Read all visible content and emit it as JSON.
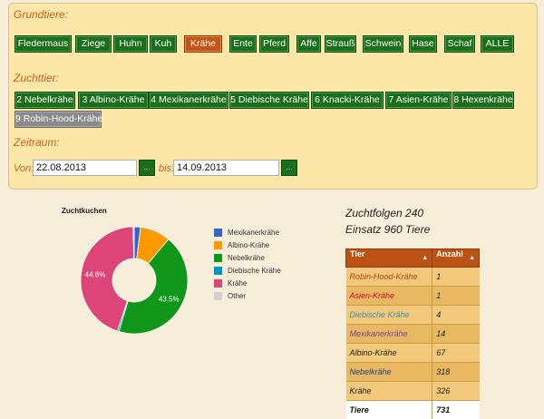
{
  "grundtiere": {
    "label": "Grundtiere:",
    "buttons": [
      "Fledermaus",
      "Ziege",
      "Huhn",
      "Kuh",
      "Krähe",
      "Ente",
      "Pferd",
      "Affe",
      "Strauß",
      "Schwein",
      "Hase",
      "Schaf",
      "ALLE"
    ],
    "active": "Krähe"
  },
  "zuchttier": {
    "label": "Zuchttier:",
    "buttons": [
      "2 Nebelkrähe",
      "3 Albino-Krähe",
      "4 Mexikanerkrähe",
      "5 Diebische Krähe",
      "6 Knacki-Krähe",
      "7 Asien-Krähe",
      "8 Hexenkrähe",
      "9 Robin-Hood-Krähe"
    ],
    "selected": "9 Robin-Hood-Krähe"
  },
  "zeitraum": {
    "label": "Zeitraum:",
    "von_label": "Von:",
    "von_value": "22.08.2013",
    "bis_label": "bis:",
    "bis_value": "14.09.2013",
    "picker_label": "..."
  },
  "chart_data": {
    "type": "pie",
    "title": "Zuchtkuchen",
    "donut": true,
    "legend_position": "right",
    "labels": [
      "Mexikanerkrähe",
      "Albino-Krähe",
      "Nebelkrähe",
      "Diebische Krähe",
      "Krähe",
      "Other"
    ],
    "values": [
      1.9,
      9.2,
      43.5,
      0.5,
      44.6,
      0.3
    ],
    "colors": [
      "#3366cc",
      "#ff9900",
      "#109618",
      "#0099c6",
      "#dd4477",
      "#d0d0d0"
    ],
    "data_labels": [
      "43.5%",
      "44.6%"
    ]
  },
  "stats": {
    "zuchtfolgen": "Zuchtfolgen 240",
    "einsatz": "Einsatz 960 Tiere"
  },
  "table": {
    "headers": [
      "Tier",
      "Anzahl"
    ],
    "rows": [
      {
        "tier": "Robin-Hood-Krähe",
        "anzahl": "1",
        "color": "#b8401b"
      },
      {
        "tier": "Asien-Krähe",
        "anzahl": "1",
        "color": "#d0102c"
      },
      {
        "tier": "Diebische Krähe",
        "anzahl": "4",
        "color": "#3f8fb0"
      },
      {
        "tier": "Mexikanerkrähe",
        "anzahl": "14",
        "color": "#7b3b9c"
      },
      {
        "tier": "Albino-Krähe",
        "anzahl": "67",
        "color": "#222222"
      },
      {
        "tier": "Nebelkrähe",
        "anzahl": "318",
        "color": "#1e3e7a"
      },
      {
        "tier": "Krähe",
        "anzahl": "326",
        "color": "#222222"
      }
    ],
    "total_label": "Tiere",
    "total_value": "731"
  }
}
